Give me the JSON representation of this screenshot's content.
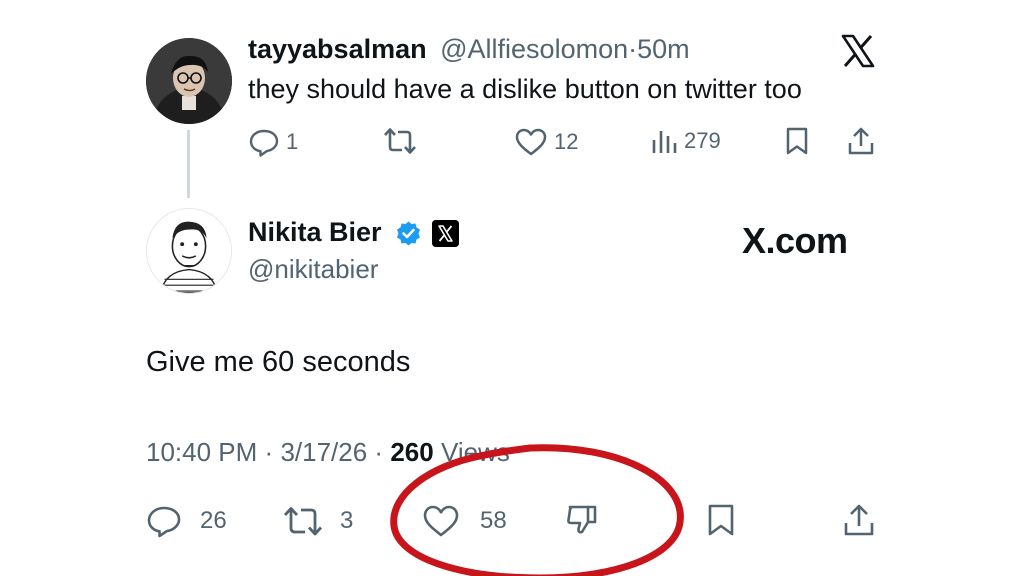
{
  "parent_tweet": {
    "display_name": "tayyabsalman",
    "handle": "@Allfiesolomon",
    "separator": "·",
    "time_ago": "50m",
    "text": "they should have a dislike button on twitter too",
    "actions": {
      "replies": "1",
      "reposts": "",
      "likes": "12",
      "views": "279"
    }
  },
  "main_tweet": {
    "display_name": "Nikita Bier",
    "handle": "@nikitabier",
    "brand_text": "X.com",
    "text": "Give me 60 seconds",
    "meta": {
      "time": "10:40 PM",
      "sep1": "·",
      "date": "3/17/26",
      "sep2": "·",
      "views_count": "260",
      "views_label": "Views"
    },
    "actions": {
      "replies": "26",
      "reposts": "3",
      "likes": "58"
    }
  },
  "icons": {
    "close_or_logo": "x-logo-icon",
    "verified": "verified-badge-icon",
    "affiliate": "x-affiliate-badge-icon",
    "reply": "reply-icon",
    "repost": "repost-icon",
    "like": "heart-icon",
    "views": "views-icon",
    "bookmark": "bookmark-icon",
    "share": "share-icon",
    "dislike": "thumbs-down-icon"
  },
  "colors": {
    "text_primary": "#0f1419",
    "text_secondary": "#536471",
    "verified_blue": "#1d9bf0",
    "annotation_red": "#c8141b",
    "thread_line": "#cfd9de"
  }
}
